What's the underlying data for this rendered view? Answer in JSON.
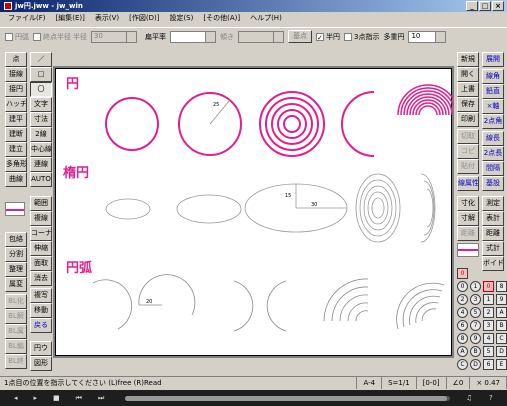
{
  "window": {
    "title": "jw円.jww - jw_win",
    "min": "_",
    "max": "□",
    "close": "×"
  },
  "menu": [
    "ファイル(F)",
    "[編集(E)]",
    "表示(V)",
    "[作図(D)]",
    "設定(S)",
    "[その他(A)]",
    "ヘルプ(H)"
  ],
  "toolbar": {
    "chk1": "円弧",
    "chk2": "終点半径",
    "chk3": "半径",
    "r_value": "30",
    "flatness_label": "扁平率",
    "tilt_label": "傾き",
    "base": "基点",
    "half": "半円",
    "point3": "3点指示",
    "multi_label": "多重円",
    "multi_value": "10"
  },
  "left_tools": [
    "点",
    "／",
    "接線",
    "□",
    "接円",
    "〇",
    "ハッチ",
    "文字",
    "建平",
    "寸法",
    "建断",
    "2線",
    "建立",
    "中心線",
    "多角形",
    "連線",
    "曲線",
    "AUTO",
    "範囲",
    "複線",
    "コーナー",
    "伸縮",
    "面取",
    "消去",
    "複写",
    "移動",
    "戻る"
  ],
  "left_extra": [
    "包絡",
    "分割",
    "整理",
    "属変",
    "BL化",
    "BL解",
    "BL属",
    "BL編",
    "BL終"
  ],
  "right_tools": [
    "新規",
    "展開",
    "開く",
    "線角",
    "上書",
    "鉛直",
    "保存",
    "×軸",
    "印刷",
    "2点角",
    "切取",
    "線長",
    "コピ",
    "2点長",
    "貼付",
    "間隔",
    "線属性",
    "基設",
    "寸化",
    "測定",
    "寸解",
    "表計",
    "距離",
    "式計",
    "ボイド",
    "円ウ",
    "図形"
  ],
  "layers": [
    "0",
    "1",
    "2",
    "3",
    "4",
    "5",
    "6",
    "7",
    "8",
    "9",
    "A",
    "B",
    "C",
    "D",
    "E",
    "F"
  ],
  "labels": {
    "circle": "円",
    "ellipse": "楕円",
    "arc": "円弧"
  },
  "dims": {
    "d1": "25",
    "d2": "15",
    "d3": "30",
    "d4": "20"
  },
  "status": {
    "message": "1点目の位置を指示してください (L)free (R)Read",
    "paper": "A-4",
    "scale": "S=1/1",
    "layer": "[0-0]",
    "angle": "∠0",
    "zoom": "× 0.47"
  },
  "player": {
    "b1": "◂",
    "b2": "▸",
    "b3": "■",
    "b4": "⏮",
    "b5": "⏭",
    "vol": "♫",
    "help": "?"
  },
  "colors": {
    "accent": "#e0208c"
  }
}
